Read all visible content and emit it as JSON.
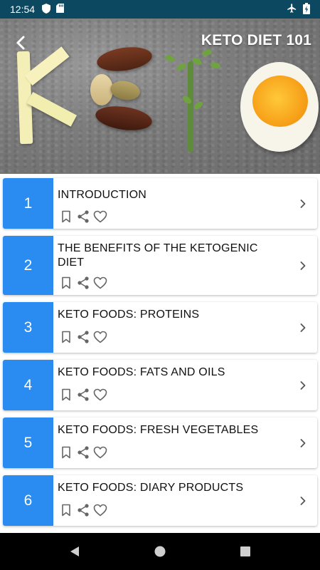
{
  "status_bar": {
    "time": "12:54",
    "left_icons": [
      "shield-icon",
      "sd-card-icon"
    ],
    "right_icons": [
      "airplane-icon",
      "battery-charging-icon"
    ]
  },
  "header": {
    "title": "KETO DIET 101",
    "back_icon": "chevron-left-icon"
  },
  "colors": {
    "status_bar": "#0c4960",
    "number_block": "#2a8bf0",
    "nav_bar": "#000000"
  },
  "chapters": [
    {
      "number": "1",
      "title": "INTRODUCTION"
    },
    {
      "number": "2",
      "title": "THE BENEFITS OF THE KETOGENIC DIET"
    },
    {
      "number": "3",
      "title": "KETO FOODS: PROTEINS"
    },
    {
      "number": "4",
      "title": "KETO FOODS: FATS AND OILS"
    },
    {
      "number": "5",
      "title": "KETO FOODS: FRESH VEGETABLES"
    },
    {
      "number": "6",
      "title": "KETO FOODS: DIARY PRODUCTS"
    }
  ],
  "card_actions": [
    "bookmark-icon",
    "share-icon",
    "heart-icon"
  ],
  "nav_bar": [
    "back-triangle-icon",
    "home-circle-icon",
    "recents-square-icon"
  ]
}
